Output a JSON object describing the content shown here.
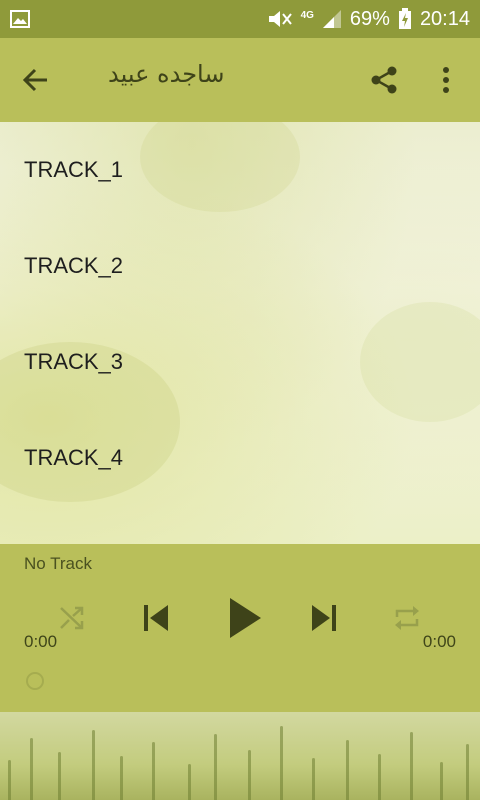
{
  "status_bar": {
    "battery_percent": "69%",
    "time": "20:14",
    "network": "4G"
  },
  "app_bar": {
    "title": "ساجده عبيد"
  },
  "tracks": [
    {
      "label": "TRACK_1"
    },
    {
      "label": "TRACK_2"
    },
    {
      "label": "TRACK_3"
    },
    {
      "label": "TRACK_4"
    }
  ],
  "player": {
    "now_playing": "No Track",
    "elapsed": "0:00",
    "duration": "0:00"
  },
  "icons": {
    "status_left": "image-icon",
    "mute": "mute-icon",
    "signal": "signal-icon",
    "battery": "battery-charging-icon",
    "back": "arrow-left-icon",
    "share": "share-icon",
    "more": "more-vert-icon",
    "shuffle": "shuffle-icon",
    "previous": "skip-previous-icon",
    "play": "play-icon",
    "next": "skip-next-icon",
    "repeat": "repeat-icon"
  },
  "colors": {
    "status_bar_bg": "#8f9a3a",
    "app_bar_bg": "#b9bf5a",
    "player_bg": "#b9bf5a",
    "icon_color": "#3e4319"
  }
}
